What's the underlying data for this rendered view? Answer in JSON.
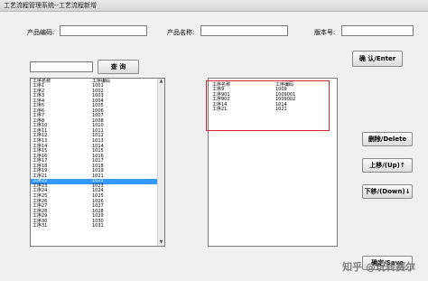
{
  "window": {
    "title": "工艺流程管理系统--工艺流程新增"
  },
  "form": {
    "product_code_label": "产品编码:",
    "product_code_value": "",
    "product_name_label": "产品名称:",
    "product_name_value": "",
    "version_label": "版本号:",
    "version_value": ""
  },
  "search": {
    "value": "",
    "button_label": "查 询"
  },
  "buttons": {
    "confirm": "确 认/Enter",
    "delete": "删除/Delete",
    "up": "上移/(Up)↑",
    "down": "下移/(Down)↓",
    "save": "确定/Save"
  },
  "left_list": {
    "columns": [
      "工序名称",
      "工序编码"
    ],
    "rows": [
      [
        "工序1",
        "1001"
      ],
      [
        "工序2",
        "1002"
      ],
      [
        "工序3",
        "1003"
      ],
      [
        "工序4",
        "1004"
      ],
      [
        "工序5",
        "1005"
      ],
      [
        "工序6",
        "1006"
      ],
      [
        "工序7",
        "1007"
      ],
      [
        "工序8",
        "1008"
      ],
      [
        "工序10",
        "1010"
      ],
      [
        "工序11",
        "1011"
      ],
      [
        "工序12",
        "1012"
      ],
      [
        "工序13",
        "1013"
      ],
      [
        "工序14",
        "1014"
      ],
      [
        "工序15",
        "1015"
      ],
      [
        "工序16",
        "1016"
      ],
      [
        "工序17",
        "1017"
      ],
      [
        "工序18",
        "1018"
      ],
      [
        "工序19",
        "1019"
      ],
      [
        "工序21",
        "1021"
      ],
      [
        "工序22",
        "1022"
      ],
      [
        "工序23",
        "1023"
      ],
      [
        "工序24",
        "1024"
      ],
      [
        "工序25",
        "1025"
      ],
      [
        "工序26",
        "1026"
      ],
      [
        "工序27",
        "1027"
      ],
      [
        "工序28",
        "1028"
      ],
      [
        "工序29",
        "1029"
      ],
      [
        "工序30",
        "1030"
      ],
      [
        "工序31",
        "1031"
      ]
    ],
    "selected_index": 19
  },
  "right_list": {
    "columns": [
      "工序名称",
      "工序编码"
    ],
    "rows": [
      [
        "工序9",
        "1009"
      ],
      [
        "工序901",
        "1009001"
      ],
      [
        "工序902",
        "1009002"
      ],
      [
        "工序14",
        "1014"
      ],
      [
        "工序21",
        "1021"
      ]
    ]
  },
  "watermark": "知乎 @玩转赛尔"
}
